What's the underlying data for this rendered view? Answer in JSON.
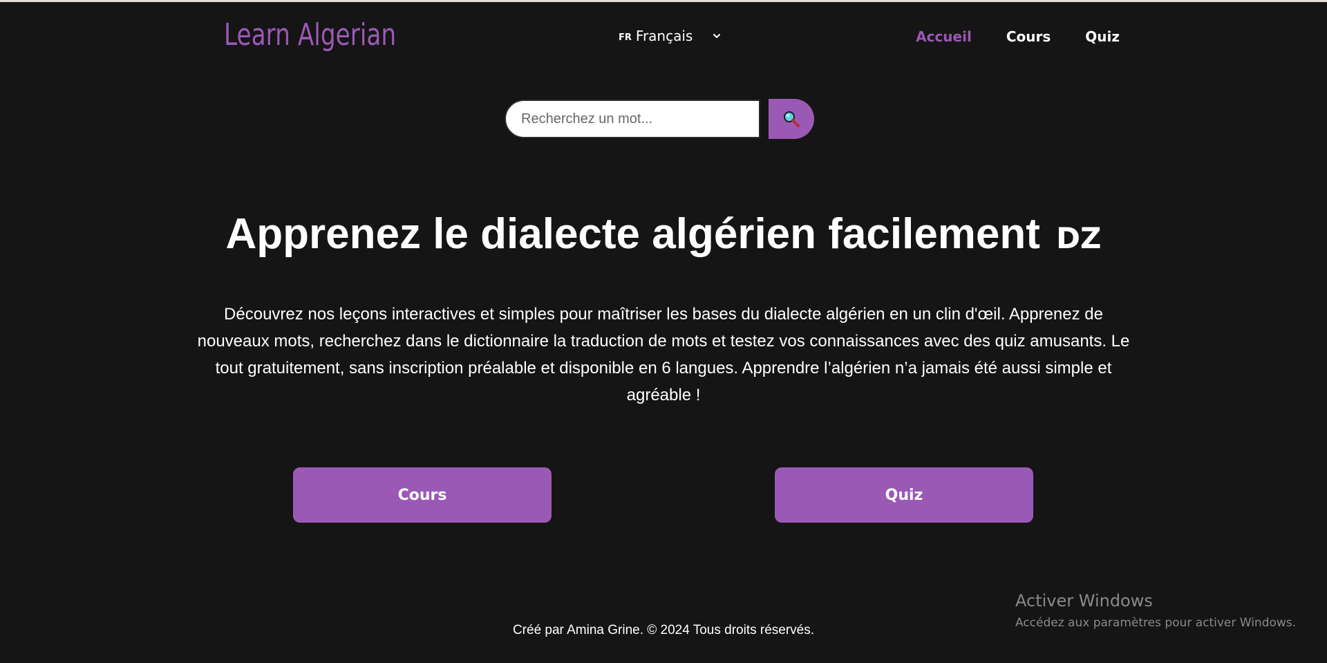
{
  "header": {
    "logo": "Learn Algerian",
    "language": {
      "flag": "FR",
      "selected": "Français"
    },
    "nav": {
      "home": "Accueil",
      "courses": "Cours",
      "quiz": "Quiz"
    }
  },
  "search": {
    "placeholder": "Recherchez un mot...",
    "button_icon": "magnifying-glass-icon"
  },
  "hero": {
    "title": "Apprenez le dialecte algérien facilement",
    "title_badge": "DZ",
    "description": "Découvrez nos leçons interactives et simples pour maîtriser les bases du dialecte algérien en un clin d'œil. Apprenez de nouveaux mots, recherchez dans le dictionnaire la traduction de mots et testez vos connaissances avec des quiz amusants. Le tout gratuitement, sans inscription préalable et disponible en 6 langues. Apprendre l’algérien n’a jamais été aussi simple et agréable !"
  },
  "actions": {
    "courses": "Cours",
    "quiz": "Quiz"
  },
  "footer": {
    "text": "Créé par Amina Grine. © 2024 Tous droits réservés."
  },
  "watermark": {
    "title": "Activer Windows",
    "subtitle": "Accédez aux paramètres pour activer Windows."
  },
  "colors": {
    "background": "#151515",
    "accent": "#9b59b6",
    "text": "#ffffff"
  }
}
